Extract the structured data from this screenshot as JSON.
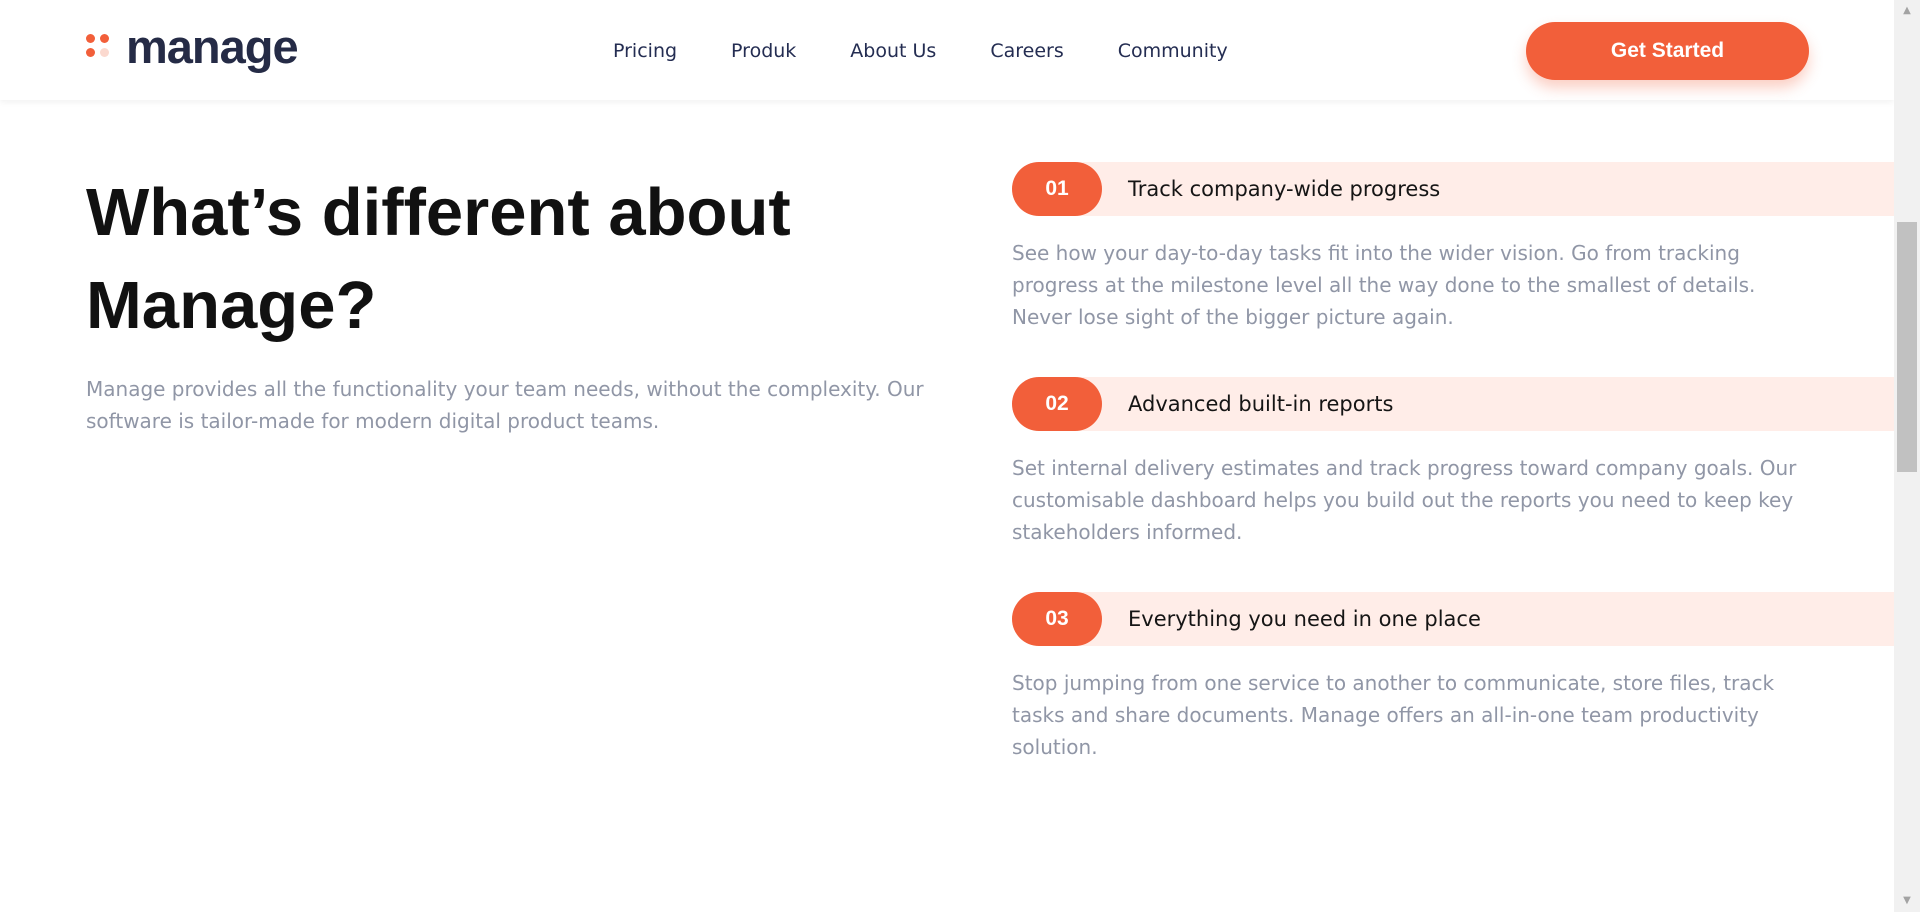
{
  "colors": {
    "accent": "#f25f3a",
    "accent_light": "#fbd9cf",
    "band": "#ffede8",
    "navy": "#242d52"
  },
  "header": {
    "logo": {
      "text": "manage",
      "icon": "four-dots-logo-icon"
    },
    "nav": [
      "Pricing",
      "Produk",
      "About Us",
      "Careers",
      "Community"
    ],
    "cta_label": "Get Started"
  },
  "hero": {
    "title": "What’s different about Manage?",
    "description": "Manage provides all the functionality your team needs, without the complexity. Our software is tailor-made for modern digital product teams."
  },
  "features": [
    {
      "number": "01",
      "title": "Track company-wide progress",
      "description": "See how your day-to-day tasks fit into the wider vision. Go from tracking progress at the milestone level all the way done to the smallest of details. Never lose sight of the bigger picture again."
    },
    {
      "number": "02",
      "title": "Advanced built-in reports",
      "description": "Set internal delivery estimates and track progress toward company goals. Our customisable dashboard helps you build out the reports you need to keep key stakeholders informed."
    },
    {
      "number": "03",
      "title": "Everything you need in one place",
      "description": "Stop jumping from one service to another to communicate, store files, track tasks and share documents. Manage offers an all-in-one team productivity solution."
    }
  ]
}
